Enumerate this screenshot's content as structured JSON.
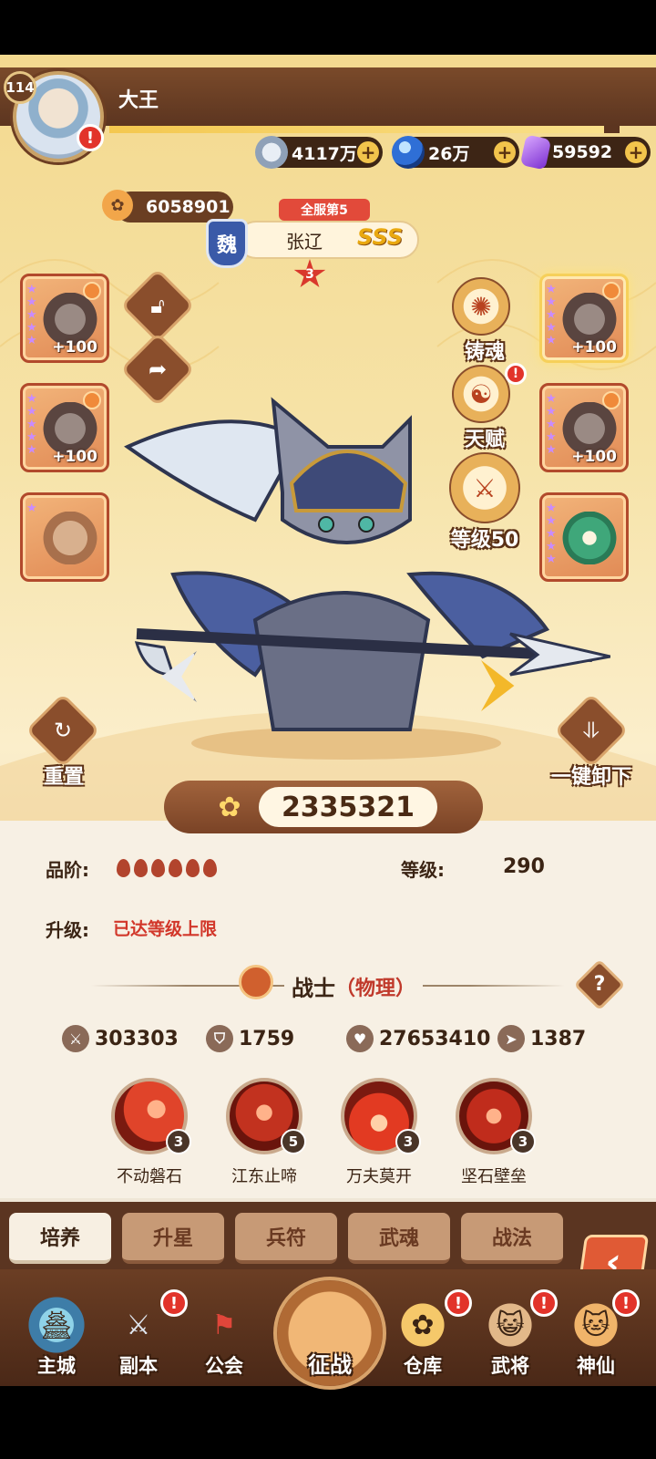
{
  "player": {
    "level": "114",
    "name": "大王",
    "power": "6058901",
    "alert": "!"
  },
  "resources": [
    {
      "icon": "coin-icon",
      "value": "4117万"
    },
    {
      "icon": "orb-icon",
      "value": "26万"
    },
    {
      "icon": "crystal-icon",
      "value": "59592"
    }
  ],
  "exp_progress": 0.97,
  "hero": {
    "server_rank": "全服第5",
    "faction": "魏",
    "name": "张辽",
    "grade": "SSS",
    "stars": "3"
  },
  "equipment_left": [
    {
      "bonus": "+100"
    },
    {
      "bonus": "+100"
    },
    {
      "bonus": ""
    }
  ],
  "equipment_right": [
    {
      "bonus": "+100"
    },
    {
      "bonus": "+100"
    },
    {
      "bonus": ""
    }
  ],
  "side_buttons": {
    "lock": "lock-icon",
    "share": "share-icon"
  },
  "feature_buttons": [
    {
      "label": "铸魂",
      "icon": "soul-cast-icon",
      "alert": ""
    },
    {
      "label": "天赋",
      "icon": "talent-icon",
      "alert": "!"
    },
    {
      "label": "等级50",
      "icon": "weapon-icon",
      "alert": ""
    }
  ],
  "reset_label": "重置",
  "unequip_label": "一键卸下",
  "combat_power": "2335321",
  "info": {
    "quality_label": "品阶:",
    "quality_pips": 6,
    "level_label": "等级:",
    "level_value": "290",
    "upgrade_label": "升级:",
    "upgrade_status": "已达等级上限",
    "class_name": "战士",
    "class_type": "（物理）",
    "help": "?"
  },
  "stats": [
    {
      "icon": "attack-icon",
      "value": "303303"
    },
    {
      "icon": "defense-icon",
      "value": "1759"
    },
    {
      "icon": "hp-icon",
      "value": "27653410"
    },
    {
      "icon": "speed-icon",
      "value": "1387"
    }
  ],
  "skills": [
    {
      "name": "不动磐石",
      "level": "3",
      "color": "#c8321e"
    },
    {
      "name": "江东止啼",
      "level": "5",
      "color": "#b2261a"
    },
    {
      "name": "万夫莫开",
      "level": "3",
      "color": "#d23a20"
    },
    {
      "name": "坚石壁垒",
      "level": "3",
      "color": "#a8281c"
    }
  ],
  "tabs": [
    {
      "label": "培养",
      "active": true
    },
    {
      "label": "升星",
      "active": false
    },
    {
      "label": "兵符",
      "active": false
    },
    {
      "label": "武魂",
      "active": false
    },
    {
      "label": "战法",
      "active": false
    }
  ],
  "back": "‹",
  "nav": [
    {
      "label": "主城",
      "icon": "castle-icon",
      "alert": ""
    },
    {
      "label": "副本",
      "icon": "sword-icon",
      "alert": "!"
    },
    {
      "label": "公会",
      "icon": "flag-icon",
      "alert": ""
    },
    {
      "label": "征战",
      "icon": "battle-icon",
      "alert": ""
    },
    {
      "label": "仓库",
      "icon": "bag-icon",
      "alert": "!"
    },
    {
      "label": "武将",
      "icon": "general-icon",
      "alert": "!"
    },
    {
      "label": "神仙",
      "icon": "cat-icon",
      "alert": "!"
    }
  ]
}
